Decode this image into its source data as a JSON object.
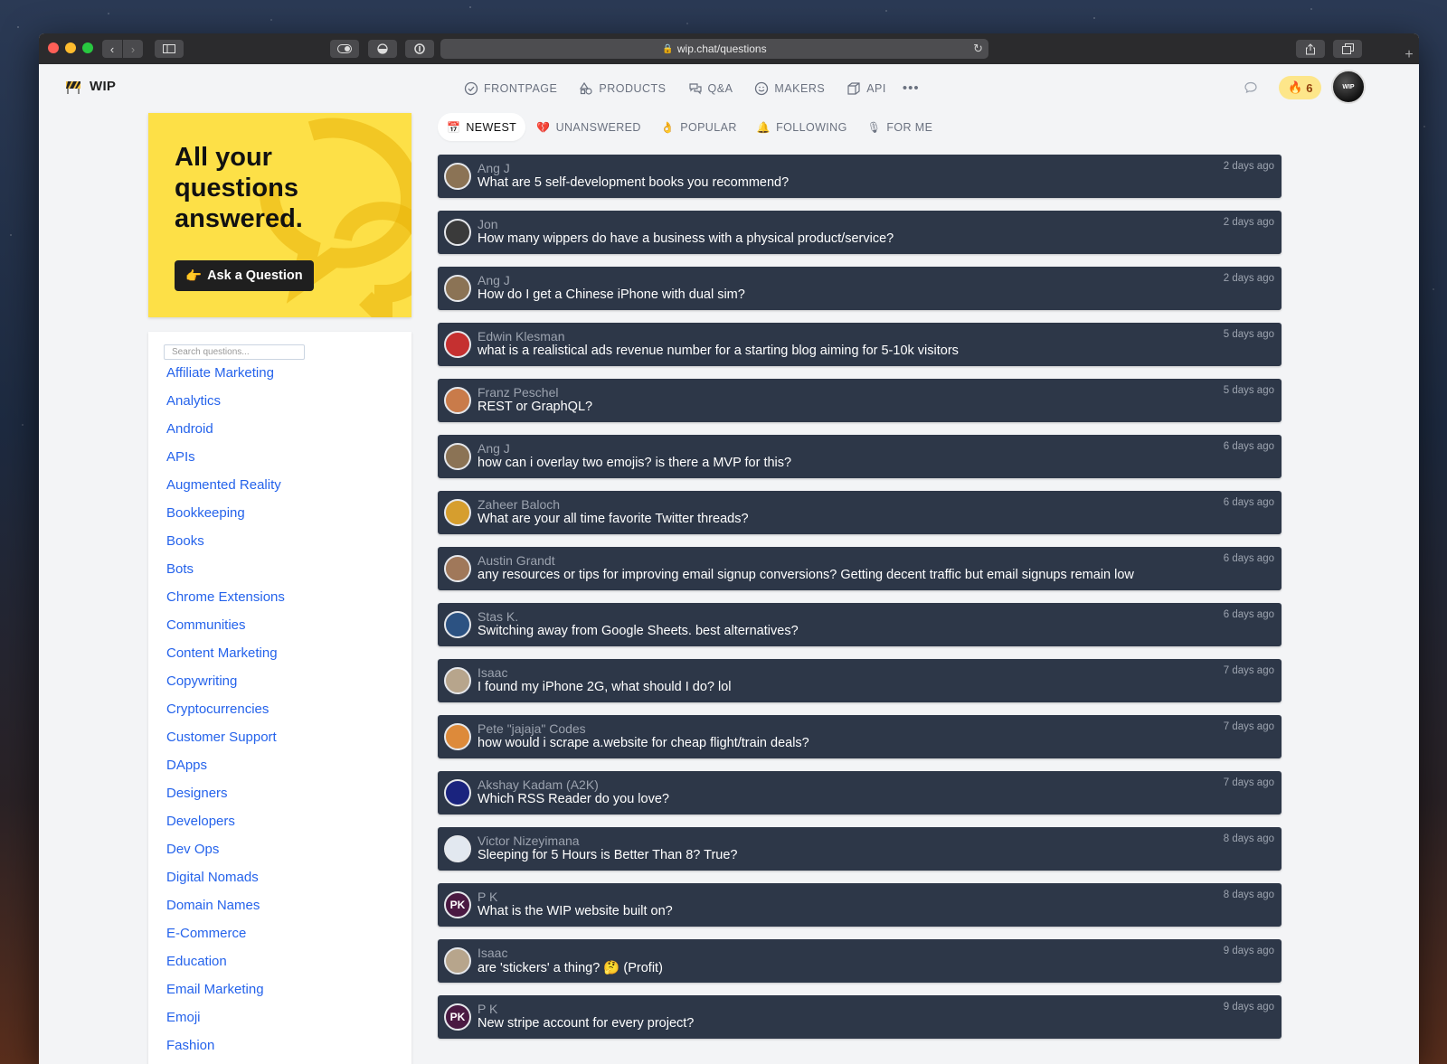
{
  "browser": {
    "url": "wip.chat/questions"
  },
  "header": {
    "brand": "WIP",
    "nav": [
      {
        "label": "FRONTPAGE",
        "icon": "check-circle-icon"
      },
      {
        "label": "PRODUCTS",
        "icon": "shapes-icon"
      },
      {
        "label": "Q&A",
        "icon": "chat-bubbles-icon"
      },
      {
        "label": "MAKERS",
        "icon": "smiley-icon"
      },
      {
        "label": "API",
        "icon": "box-icon"
      }
    ],
    "more": "•••",
    "streak_count": "6",
    "avatar_text": "WIP"
  },
  "hero": {
    "title": "All your questions answered.",
    "button_label": "Ask a Question",
    "button_emoji": "👉",
    "background": "#fde047"
  },
  "sidebar": {
    "search_placeholder": "Search questions...",
    "topics": [
      "Affiliate Marketing",
      "Analytics",
      "Android",
      "APIs",
      "Augmented Reality",
      "Bookkeeping",
      "Books",
      "Bots",
      "Chrome Extensions",
      "Communities",
      "Content Marketing",
      "Copywriting",
      "Cryptocurrencies",
      "Customer Support",
      "DApps",
      "Designers",
      "Developers",
      "Dev Ops",
      "Digital Nomads",
      "Domain Names",
      "E-Commerce",
      "Education",
      "Email Marketing",
      "Emoji",
      "Fashion"
    ]
  },
  "tabs": [
    {
      "label": "NEWEST",
      "emoji": "📅",
      "active": true
    },
    {
      "label": "UNANSWERED",
      "emoji": "💔",
      "active": false
    },
    {
      "label": "POPULAR",
      "emoji": "👌",
      "active": false
    },
    {
      "label": "FOLLOWING",
      "emoji": "🔔",
      "active": false
    },
    {
      "label": "FOR ME",
      "emoji": "🎙",
      "active": false
    }
  ],
  "questions": [
    {
      "author": "Ang J",
      "title": "What are 5 self-development books you recommend?",
      "time": "2 days ago",
      "avatar_color": "#8b7355",
      "initials": ""
    },
    {
      "author": "Jon",
      "title": "How many wippers do have a business with a physical product/service?",
      "time": "2 days ago",
      "avatar_color": "#3a3a3a",
      "initials": ""
    },
    {
      "author": "Ang J",
      "title": "How do I get a Chinese iPhone with dual sim?",
      "time": "2 days ago",
      "avatar_color": "#8b7355",
      "initials": ""
    },
    {
      "author": "Edwin Klesman",
      "title": "what is a realistical ads revenue number for a starting blog aiming for 5-10k visitors",
      "time": "5 days ago",
      "avatar_color": "#c53030",
      "initials": ""
    },
    {
      "author": "Franz Peschel",
      "title": "REST or GraphQL?",
      "time": "5 days ago",
      "avatar_color": "#c97b4a",
      "initials": ""
    },
    {
      "author": "Ang J",
      "title": "how can i overlay two emojis? is there a MVP for this?",
      "time": "6 days ago",
      "avatar_color": "#8b7355",
      "initials": ""
    },
    {
      "author": "Zaheer Baloch",
      "title": "What are your all time favorite Twitter threads?",
      "time": "6 days ago",
      "avatar_color": "#d69e2e",
      "initials": ""
    },
    {
      "author": "Austin Grandt",
      "title": "any resources or tips for improving email signup conversions? Getting decent traffic but email signups remain low",
      "time": "6 days ago",
      "avatar_color": "#a0785a",
      "initials": ""
    },
    {
      "author": "Stas K.",
      "title": "Switching away from Google Sheets. best alternatives?",
      "time": "6 days ago",
      "avatar_color": "#2c5282",
      "initials": ""
    },
    {
      "author": "Isaac",
      "title": "I found my iPhone 2G, what should I do? lol",
      "time": "7 days ago",
      "avatar_color": "#b7a58c",
      "initials": ""
    },
    {
      "author": "Pete \"jajaja\" Codes",
      "title": "how would i scrape a.website for cheap flight/train deals?",
      "time": "7 days ago",
      "avatar_color": "#dd8a3a",
      "initials": ""
    },
    {
      "author": "Akshay Kadam (A2K)",
      "title": "Which RSS Reader do you love?",
      "time": "7 days ago",
      "avatar_color": "#1a237e",
      "initials": ""
    },
    {
      "author": "Victor Nizeyimana",
      "title": "Sleeping for 5 Hours is Better Than 8? True?",
      "time": "8 days ago",
      "avatar_color": "#e2e8f0",
      "initials": ""
    },
    {
      "author": "P K",
      "title": "What is the WIP website built on?",
      "time": "8 days ago",
      "avatar_color": "#4a1942",
      "initials": "PK"
    },
    {
      "author": "Isaac",
      "title": "are 'stickers' a thing? 🤔 (Profit)",
      "time": "9 days ago",
      "avatar_color": "#b7a58c",
      "initials": ""
    },
    {
      "author": "P K",
      "title": "New stripe account for every project?",
      "time": "9 days ago",
      "avatar_color": "#4a1942",
      "initials": "PK"
    }
  ]
}
